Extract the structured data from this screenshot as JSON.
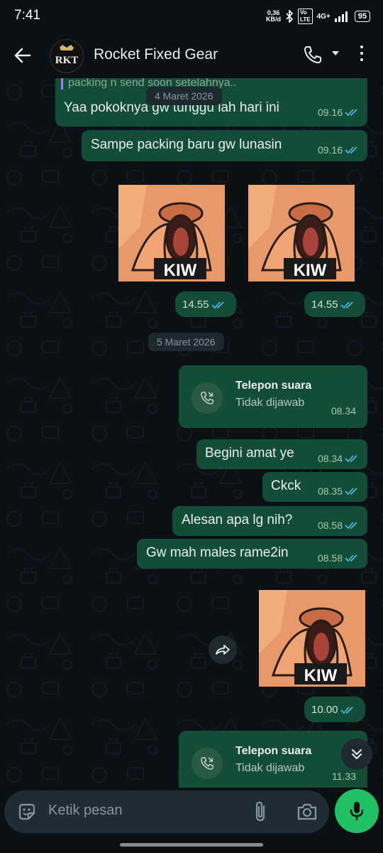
{
  "status_bar": {
    "time": "7:41",
    "speed_value": "0,36",
    "speed_unit": "KB/d",
    "bluetooth_icon": "bluetooth-icon",
    "volte_top": "Vo",
    "volte_bottom": "LTE",
    "network": "4G+",
    "battery": "95"
  },
  "header": {
    "back_icon": "arrow-left-icon",
    "contact_name": "Rocket Fixed Gear",
    "avatar_text": "RKT",
    "call_icon": "phone-icon",
    "dropdown_icon": "chevron-down-icon",
    "menu_icon": "more-vertical-icon"
  },
  "chat": {
    "quoted_preview": "packing n send soon setelahnya..",
    "messages": {
      "m1": {
        "text": "Yaa pokoknya gw tunggu lah hari ini",
        "time": "09.16"
      },
      "m2": {
        "text": "Sampe packing baru gw lunasin",
        "time": "09.16"
      },
      "sticker1": {
        "caption": "KIW",
        "time": "14.55"
      },
      "sticker2": {
        "caption": "KIW",
        "time": "14.55"
      },
      "call1": {
        "title": "Telepon suara",
        "status": "Tidak dijawab",
        "time": "08.34"
      },
      "m3": {
        "text": "Begini amat ye",
        "time": "08.34"
      },
      "m4": {
        "text": "Ckck",
        "time": "08.35"
      },
      "m5": {
        "text": "Alesan apa lg nih?",
        "time": "08.58"
      },
      "m6": {
        "text": "Gw mah males rame2in",
        "time": "08.58"
      },
      "sticker3": {
        "caption": "KIW",
        "time": "10.00"
      },
      "call2": {
        "title": "Telepon suara",
        "status": "Tidak dijawab",
        "time": "11.33"
      }
    },
    "date_chips": {
      "d1": "4 Maret 2026",
      "d2": "5 Maret 2026"
    },
    "forward_icon": "forward-icon",
    "scroll_down_icon": "double-chevron-down-icon"
  },
  "composer": {
    "placeholder": "Ketik pesan",
    "emoji_icon": "sticker-emoji-icon",
    "attach_icon": "paperclip-icon",
    "camera_icon": "camera-icon",
    "mic_icon": "microphone-icon"
  },
  "colors": {
    "background": "#0b1014",
    "outgoing_bubble": "#144d37",
    "read_ticks": "#53bdeb",
    "mic_button": "#21c063"
  }
}
